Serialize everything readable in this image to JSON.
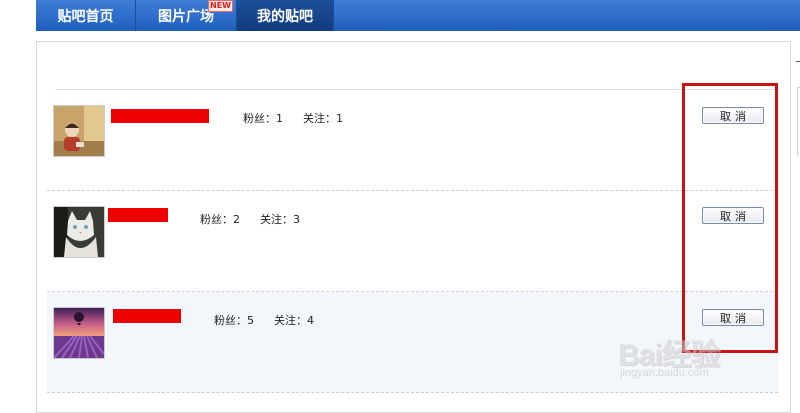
{
  "nav": {
    "tabs": [
      {
        "label": "贴吧首页"
      },
      {
        "label": "图片广场",
        "badge": "NEW"
      },
      {
        "label": "我的贴吧",
        "active": true
      }
    ]
  },
  "list": {
    "rows": [
      {
        "fans_label": "粉丝：1",
        "follow_label": "关注：1",
        "button": "取消",
        "avatar": "child-photo-icon"
      },
      {
        "fans_label": "粉丝：2",
        "follow_label": "关注：3",
        "button": "取消",
        "avatar": "cat-photo-icon"
      },
      {
        "fans_label": "粉丝：5",
        "follow_label": "关注：4",
        "button": "取消",
        "avatar": "lavender-balloon-photo-icon"
      }
    ]
  },
  "annotation": {
    "color": "#c81414"
  },
  "watermark": {
    "logo": "Bai经验",
    "url": "jingyan.baidu.com"
  },
  "colors": {
    "nav_blue": "#2f6fcb",
    "nav_active": "#174a94",
    "redaction": "#ee0000"
  }
}
